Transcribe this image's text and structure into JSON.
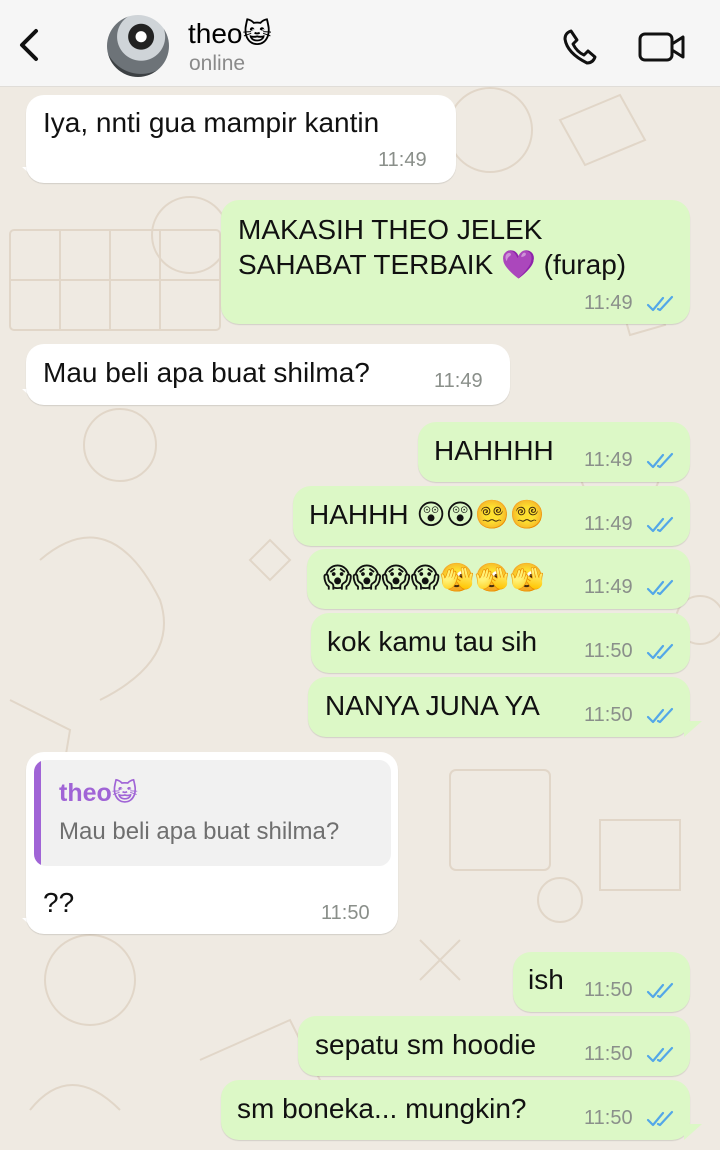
{
  "header": {
    "back_icon": "chevron-left-icon",
    "contact_name": "theo😺",
    "status": "online",
    "call_icon": "phone-icon",
    "video_icon": "video-camera-icon"
  },
  "colors": {
    "incoming_bubble": "#ffffff",
    "outgoing_bubble": "#dcf8c6",
    "read_ticks": "#53a7e8",
    "quote_accent": "#a064d6",
    "chat_background": "#efeae2"
  },
  "messages": [
    {
      "direction": "in",
      "text": "Iya, nnti gua mampir kantin",
      "time": "11:49"
    },
    {
      "direction": "out",
      "lines": [
        "MAKASIH THEO JELEK",
        "SAHABAT TERBAIK 💜 (furap)"
      ],
      "time": "11:49",
      "status": "read"
    },
    {
      "direction": "in",
      "text": "Mau beli apa buat shilma?",
      "time": "11:49"
    },
    {
      "direction": "out",
      "text": "HAHHHH",
      "time": "11:49",
      "status": "read"
    },
    {
      "direction": "out",
      "text": "HAHHH 😲😲😵‍💫😵‍💫",
      "time": "11:49",
      "status": "read"
    },
    {
      "direction": "out",
      "text": "😱😱😱😱🫣🫣🫣",
      "time": "11:49",
      "status": "read"
    },
    {
      "direction": "out",
      "text": "kok kamu tau sih",
      "time": "11:50",
      "status": "read"
    },
    {
      "direction": "out",
      "text": "NANYA JUNA YA",
      "time": "11:50",
      "status": "read"
    },
    {
      "direction": "in",
      "reply_to": {
        "name": "theo😺",
        "text": "Mau beli apa buat shilma?"
      },
      "text": "??",
      "time": "11:50"
    },
    {
      "direction": "out",
      "text": "ish",
      "time": "11:50",
      "status": "read"
    },
    {
      "direction": "out",
      "text": "sepatu sm hoodie",
      "time": "11:50",
      "status": "read"
    },
    {
      "direction": "out",
      "text": "sm boneka... mungkin?",
      "time": "11:50",
      "status": "read"
    }
  ]
}
